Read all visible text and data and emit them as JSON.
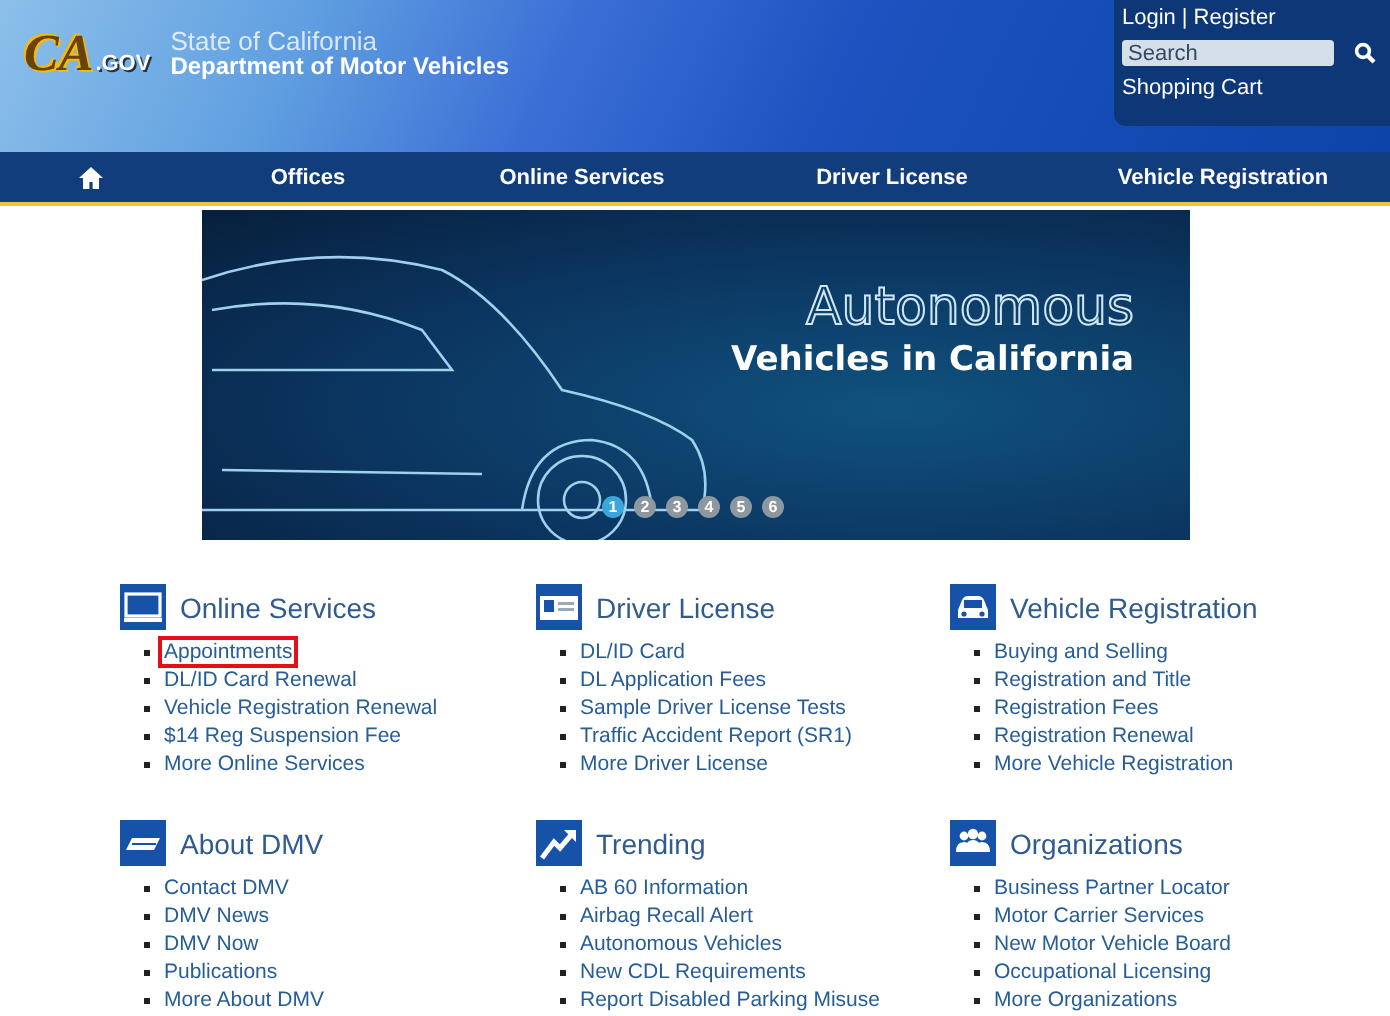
{
  "header": {
    "logo": {
      "mark": "CA",
      "suffix": ".GOV"
    },
    "agency": "State of California",
    "department": "Department of Motor Vehicles",
    "account": {
      "login": "Login",
      "separator": "|",
      "register": "Register",
      "search_placeholder": "Search",
      "cart": "Shopping Cart"
    }
  },
  "nav": [
    {
      "kind": "home"
    },
    {
      "kind": "link",
      "label": "Offices"
    },
    {
      "kind": "link",
      "label": "Online Services"
    },
    {
      "kind": "link",
      "label": "Driver License"
    },
    {
      "kind": "link",
      "label": "Vehicle Registration"
    }
  ],
  "banner": {
    "title": "Autonomous",
    "subtitle": "Vehicles in California",
    "slides": [
      {
        "label": "1",
        "selected": true
      },
      {
        "label": "2",
        "selected": false
      },
      {
        "label": "3",
        "selected": false
      },
      {
        "label": "4",
        "selected": false
      },
      {
        "label": "5",
        "selected": false
      },
      {
        "label": "6",
        "selected": false
      }
    ]
  },
  "sections": [
    {
      "title": "Online Services",
      "items": [
        {
          "label": "Appointments",
          "highlighted": true
        },
        {
          "label": "DL/ID Card Renewal",
          "highlighted": false
        },
        {
          "label": "Vehicle Registration Renewal",
          "highlighted": false
        },
        {
          "label": "$14 Reg Suspension Fee",
          "highlighted": false
        },
        {
          "label": "More Online Services",
          "highlighted": false
        }
      ]
    },
    {
      "title": "Driver License",
      "items": [
        {
          "label": "DL/ID Card",
          "highlighted": false
        },
        {
          "label": "DL Application Fees",
          "highlighted": false
        },
        {
          "label": "Sample Driver License Tests",
          "highlighted": false
        },
        {
          "label": "Traffic Accident Report (SR1)",
          "highlighted": false
        },
        {
          "label": "More Driver License",
          "highlighted": false
        }
      ]
    },
    {
      "title": "Vehicle Registration",
      "items": [
        {
          "label": "Buying and Selling",
          "highlighted": false
        },
        {
          "label": "Registration and Title",
          "highlighted": false
        },
        {
          "label": "Registration Fees",
          "highlighted": false
        },
        {
          "label": "Registration Renewal",
          "highlighted": false
        },
        {
          "label": "More Vehicle Registration",
          "highlighted": false
        }
      ]
    },
    {
      "title": "About DMV",
      "items": [
        {
          "label": "Contact DMV",
          "highlighted": false
        },
        {
          "label": "DMV News",
          "highlighted": false
        },
        {
          "label": "DMV Now",
          "highlighted": false
        },
        {
          "label": "Publications",
          "highlighted": false
        },
        {
          "label": "More About DMV",
          "highlighted": false
        }
      ]
    },
    {
      "title": "Trending",
      "items": [
        {
          "label": "AB 60 Information",
          "highlighted": false
        },
        {
          "label": "Airbag Recall Alert",
          "highlighted": false
        },
        {
          "label": "Autonomous Vehicles",
          "highlighted": false
        },
        {
          "label": "New CDL Requirements",
          "highlighted": false
        },
        {
          "label": "Report Disabled Parking Misuse",
          "highlighted": false
        }
      ]
    },
    {
      "title": "Organizations",
      "items": [
        {
          "label": "Business Partner Locator",
          "highlighted": false
        },
        {
          "label": "Motor Carrier Services",
          "highlighted": false
        },
        {
          "label": "New Motor Vehicle Board",
          "highlighted": false
        },
        {
          "label": "Occupational Licensing",
          "highlighted": false
        },
        {
          "label": "More Organizations",
          "highlighted": false
        }
      ]
    }
  ]
}
